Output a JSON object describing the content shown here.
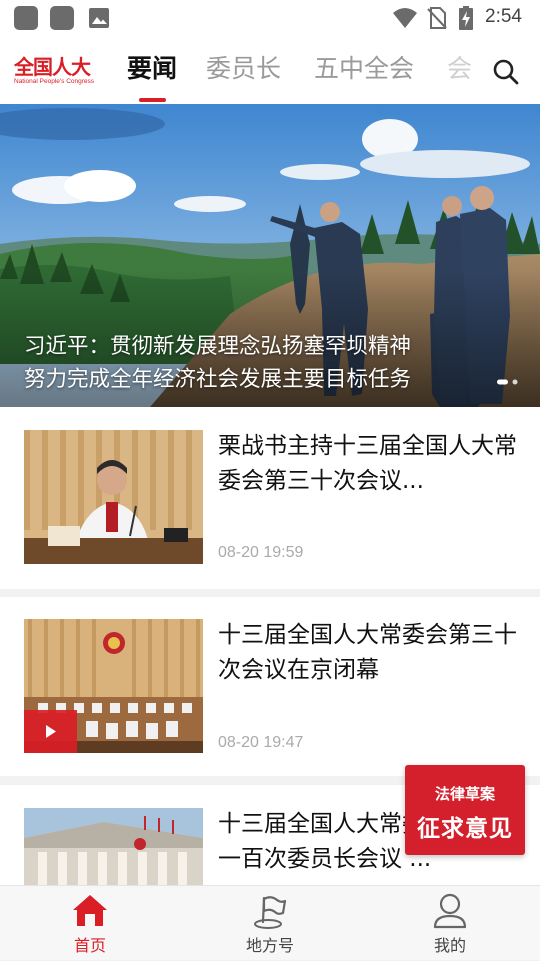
{
  "status_bar": {
    "time": "2:54",
    "icons": [
      "app-icon",
      "app-icon",
      "image-icon",
      "wifi-icon",
      "no-sim-icon",
      "battery-charging-icon"
    ]
  },
  "header": {
    "logo_text": "全国人大",
    "logo_subtext": "National People's Congress",
    "tabs": [
      {
        "label": "要闻",
        "active": true
      },
      {
        "label": "委员长",
        "active": false
      },
      {
        "label": "五中全会",
        "active": false
      },
      {
        "label": "会",
        "active": false
      }
    ],
    "search_icon": "search-icon",
    "accent_color": "#d91e26"
  },
  "hero": {
    "headline_line1": "习近平：贯彻新发展理念弘扬塞罕坝精神",
    "headline_line2": "努力完成全年经济社会发展主要目标任务",
    "slide_count": 2,
    "active_slide": 1
  },
  "news": [
    {
      "title": "栗战书主持十三届全国人大常委会第三十次会议...",
      "time": "08-20 19:59",
      "is_video": false
    },
    {
      "title": "十三届全国人大常委会第三十次会议在京闭幕",
      "time": "08-20 19:47",
      "is_video": true
    },
    {
      "title": "十三届全国人大常委会举行第一百次委员长会议 ...",
      "time": "",
      "is_video": false
    }
  ],
  "float_ad": {
    "line1": "法律草案",
    "line2": "征求意见",
    "color": "#d4202c"
  },
  "bottom_nav": {
    "items": [
      {
        "label": "首页",
        "icon": "home-icon",
        "active": true
      },
      {
        "label": "地方号",
        "icon": "flag-icon",
        "active": false
      },
      {
        "label": "我的",
        "icon": "user-icon",
        "active": false
      }
    ]
  }
}
